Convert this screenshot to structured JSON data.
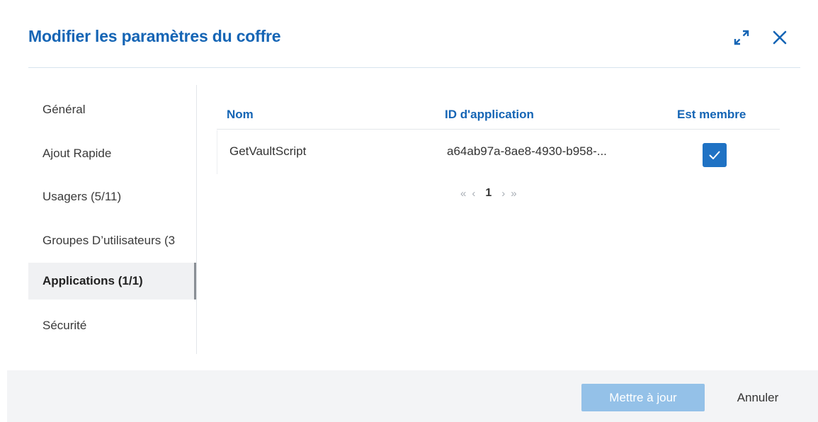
{
  "dialog": {
    "title": "Modifier les paramètres du coffre"
  },
  "icons": {
    "expand": "expand-icon",
    "close": "close-icon",
    "check": "check-icon",
    "first_page": "double-chevron-left-icon",
    "prev_page": "chevron-left-icon",
    "next_page": "chevron-right-icon",
    "last_page": "double-chevron-right-icon"
  },
  "colors": {
    "accent": "#1565b5",
    "checkbox": "#1f72c4",
    "primary_button_disabled": "#94c1e8"
  },
  "sidebar": {
    "items": [
      {
        "label": "Général",
        "active": false
      },
      {
        "label": "Ajout Rapide",
        "active": false
      },
      {
        "label": "Usagers (5/11)",
        "active": false
      },
      {
        "label": "Groupes D’utilisateurs (3",
        "active": false
      },
      {
        "label": "Applications (1/1)",
        "active": true
      },
      {
        "label": "Sécurité",
        "active": false
      }
    ]
  },
  "table": {
    "columns": [
      "Nom",
      "ID d'application",
      "Est membre"
    ],
    "rows": [
      {
        "name": "GetVaultScript",
        "app_id": "a64ab97a-8ae8-4930-b958-...",
        "is_member": true
      }
    ]
  },
  "pagination": {
    "first": "«",
    "prev": "‹",
    "current": "1",
    "next": "›",
    "last": "»"
  },
  "footer": {
    "update_label": "Mettre à jour",
    "cancel_label": "Annuler"
  }
}
